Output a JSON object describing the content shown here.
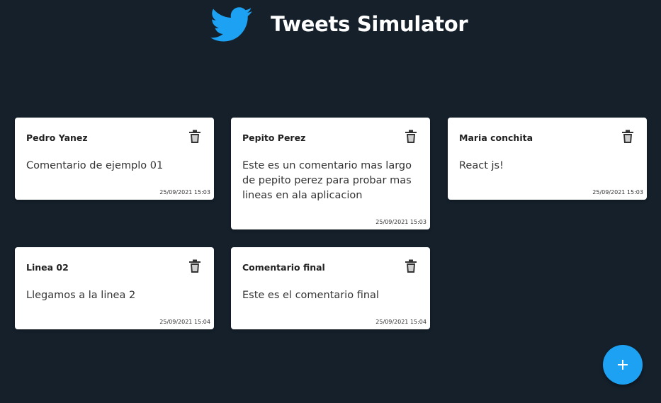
{
  "app": {
    "title": "Tweets Simulator",
    "logo_icon": "twitter-bird-icon",
    "brand_color": "#1da1f2",
    "background_color": "#15202b"
  },
  "tweets": [
    {
      "user": "Pedro Yanez",
      "text": "Comentario de ejemplo 01",
      "date": "25/09/2021 15:03",
      "delete_icon": "trash-icon"
    },
    {
      "user": "Pepito Perez",
      "text": "Este es un comentario mas largo de pepito perez para probar mas lineas en ala aplicacion",
      "date": "25/09/2021 15:03",
      "delete_icon": "trash-icon"
    },
    {
      "user": "Maria conchita",
      "text": "React js!",
      "date": "25/09/2021 15:03",
      "delete_icon": "trash-icon"
    },
    {
      "user": "Linea 02",
      "text": "Llegamos a la linea 2",
      "date": "25/09/2021 15:04",
      "delete_icon": "trash-icon"
    },
    {
      "user": "Comentario final",
      "text": "Este es el comentario final",
      "date": "25/09/2021 15:04",
      "delete_icon": "trash-icon"
    }
  ],
  "fab": {
    "icon": "plus-icon",
    "color": "#1da1f2"
  }
}
